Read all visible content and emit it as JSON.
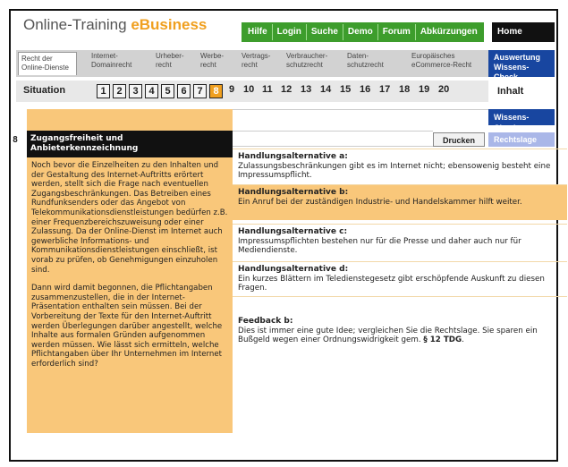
{
  "header": {
    "title_main": "Online-Training ",
    "title_accent": "eBusiness",
    "nav": [
      "Hilfe",
      "Login",
      "Suche",
      "Demo",
      "Forum",
      "Abkürzungen"
    ],
    "home": "Home"
  },
  "tabs": [
    {
      "l1": "Recht der",
      "l2": "Online-Dienste"
    },
    {
      "l1": "Internet-",
      "l2": "Domainrecht"
    },
    {
      "l1": "Urheber-",
      "l2": "recht"
    },
    {
      "l1": "Werbe-",
      "l2": "recht"
    },
    {
      "l1": "Vertrags-",
      "l2": "recht"
    },
    {
      "l1": "Verbraucher-",
      "l2": "schutzrecht"
    },
    {
      "l1": "Daten-",
      "l2": "schutzrecht"
    },
    {
      "l1": "Europäisches",
      "l2": "eCommerce-Recht"
    }
  ],
  "side": {
    "auswertung_l1": "Auswertung",
    "auswertung_l2": "Wissens-Check",
    "inhalt": "Inhalt",
    "wissens_check": "Wissens-Check",
    "rechtslage": "Rechtslage"
  },
  "situation": {
    "label": "Situation",
    "numbers": [
      "1",
      "2",
      "3",
      "4",
      "5",
      "6",
      "7",
      "8",
      "9",
      "10",
      "11",
      "12",
      "13",
      "14",
      "15",
      "16",
      "17",
      "18",
      "19",
      "20"
    ]
  },
  "content": {
    "section_number": "8",
    "section_title": "Zugangsfreiheit und Anbieterkennzeichnung",
    "drucken": "Drucken",
    "paragraph1": "Noch bevor die Einzelheiten zu den Inhalten und der Gestaltung des Internet-Auftritts erörtert werden, stellt sich die Frage nach eventuellen Zugangsbeschränkungen. Das Betreiben eines Rundfunksenders oder das Angebot von Telekommunikationsdienstleistungen bedürfen z.B. einer Frequenzbereichszuweisung oder einer Zulassung. Da der Online-Dienst im Internet auch gewerbliche Informations- und Kommunikationsdienstleistungen einschließt, ist vorab zu prüfen, ob Genehmigungen einzuholen sind.",
    "paragraph2": "Dann wird damit begonnen, die Pflichtangaben zusammenzustellen, die in der Internet-Präsentation enthalten sein müssen. Bei der Vorbereitung der Texte für den Internet-Auftritt werden Überlegungen darüber angestellt, welche Inhalte aus formalen Gründen aufgenommen werden müssen. Wie lässt sich ermitteln, welche Pflichtangaben über Ihr Unternehmen im Internet erforderlich sind?",
    "alternatives": [
      {
        "title": "Handlungsalternative a:",
        "text": "Zulassungsbeschränkungen gibt es im Internet nicht; ebensowenig besteht eine Impressumspflicht."
      },
      {
        "title": "Handlungsalternative b:",
        "text": "Ein Anruf bei der zuständigen Industrie- und Handelskammer hilft weiter."
      },
      {
        "title": "Handlungsalternative c:",
        "text": "Impressumspflichten bestehen nur für die Presse und daher auch nur für Mediendienste."
      },
      {
        "title": "Handlungsalternative d:",
        "text": "Ein kurzes Blättern im Teledienstegesetz gibt erschöpfende Auskunft zu diesen Fragen."
      }
    ],
    "feedback_title": "Feedback b:",
    "feedback_text": "Dies ist immer eine gute Idee; vergleichen Sie die Rechtslage. Sie sparen ein Bußgeld wegen einer Ordnungswidrigkeit gem. ",
    "feedback_ref": "§ 12 TDG",
    "feedback_end": "."
  },
  "colors": {
    "green_nav": "#3d9d2c",
    "orange_accent": "#f0a020",
    "orange_panel": "#f9c77a",
    "blue_button": "#1846a0",
    "lavender_button": "#aab7e8"
  }
}
